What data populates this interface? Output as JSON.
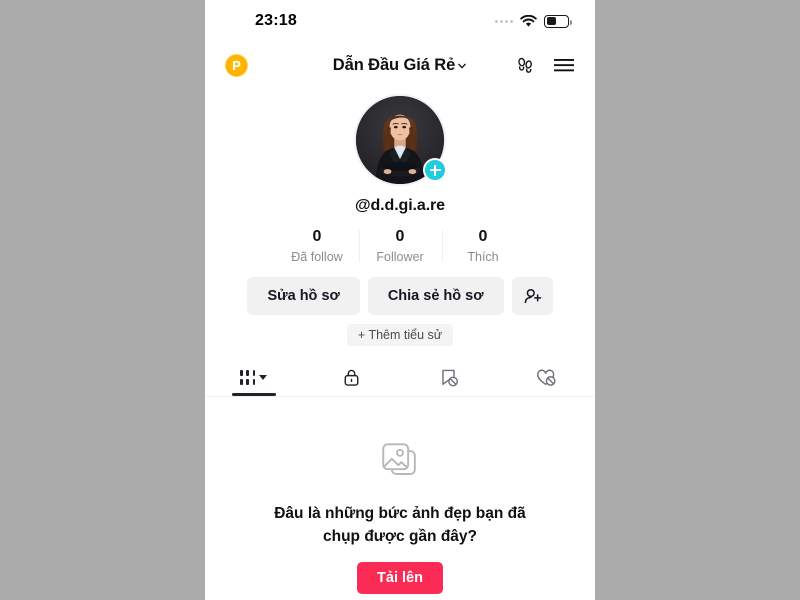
{
  "status_bar": {
    "time": "23:18",
    "signal_icon": "signal-dots-icon",
    "wifi_icon": "wifi-icon",
    "battery_icon": "battery-icon"
  },
  "header": {
    "coin_badge_label": "P",
    "title": "Dẫn Đầu Giá Rẻ",
    "title_chevron_icon": "chevron-down-icon",
    "footprints_icon": "footprints-icon",
    "menu_icon": "hamburger-menu-icon"
  },
  "profile": {
    "avatar_alt": "profile-photo",
    "add_badge_icon": "plus-icon",
    "handle": "@d.d.gi.a.re",
    "stats": [
      {
        "value": "0",
        "label": "Đã follow"
      },
      {
        "value": "0",
        "label": "Follower"
      },
      {
        "value": "0",
        "label": "Thích"
      }
    ],
    "actions": {
      "edit_label": "Sửa hồ sơ",
      "share_label": "Chia sẻ hồ sơ",
      "add_friend_icon": "add-person-icon"
    },
    "bio_label": "+ Thêm tiểu sử"
  },
  "tabs": [
    {
      "name": "posts",
      "icon": "grid-posts-icon",
      "active": true
    },
    {
      "name": "private",
      "icon": "lock-icon",
      "active": false
    },
    {
      "name": "saved",
      "icon": "bookmark-slash-icon",
      "active": false
    },
    {
      "name": "liked",
      "icon": "heart-slash-icon",
      "active": false
    }
  ],
  "empty_state": {
    "icon": "photo-stack-icon",
    "title": "Đâu là những bức ảnh đẹp bạn đã chụp được gần đây?",
    "upload_label": "Tải lên"
  },
  "colors": {
    "page_background": "#ababab",
    "accent_red": "#fa2b55",
    "accent_cyan": "#21ccdf",
    "coin_orange": "#ffb300",
    "button_gray": "#f1f1f2",
    "text_primary": "#111111",
    "text_muted": "#8c8c8c"
  }
}
